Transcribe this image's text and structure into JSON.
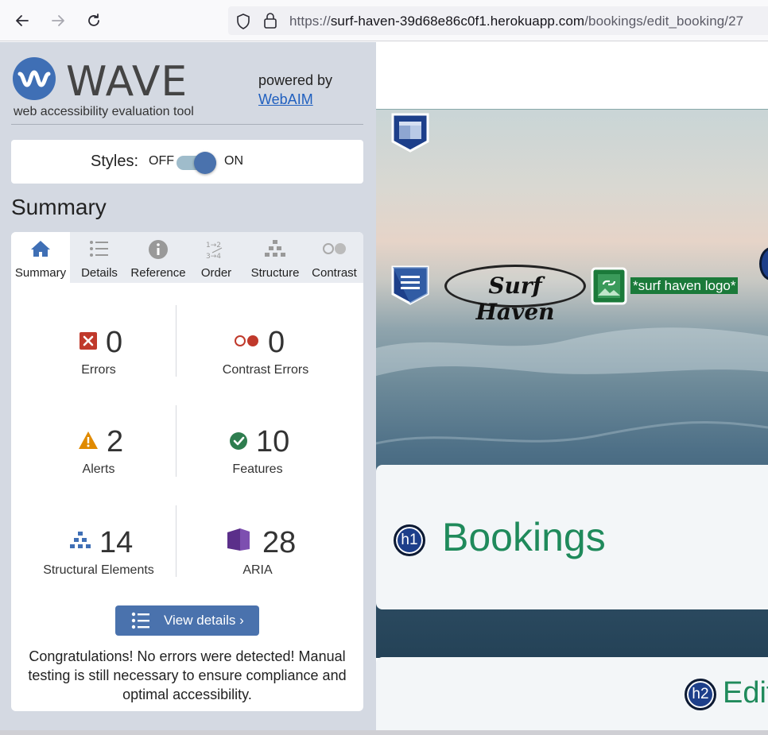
{
  "browser": {
    "url_prefix": "https://",
    "url_host": "surf-haven-39d68e86c0f1.herokuapp.com",
    "url_path": "/bookings/edit_booking/27",
    "icons": [
      "back-arrow-icon",
      "forward-arrow-icon",
      "reload-icon",
      "shield-icon",
      "lock-icon"
    ]
  },
  "wave": {
    "brand": "WAVE",
    "subtitle": "web accessibility evaluation tool",
    "powered_by": "powered by",
    "webaim_link": "WebAIM",
    "styles_label": "Styles:",
    "toggle_off": "OFF",
    "toggle_on": "ON",
    "toggle_state": "on",
    "summary_heading": "Summary",
    "tabs": [
      {
        "label": "Summary",
        "icon": "home-icon",
        "active": true
      },
      {
        "label": "Details",
        "icon": "list-icon",
        "active": false
      },
      {
        "label": "Reference",
        "icon": "info-icon",
        "active": false
      },
      {
        "label": "Order",
        "icon": "order-icon",
        "active": false
      },
      {
        "label": "Structure",
        "icon": "structure-icon",
        "active": false
      },
      {
        "label": "Contrast",
        "icon": "contrast-icon",
        "active": false
      }
    ],
    "stats": {
      "errors": {
        "value": "0",
        "label": "Errors"
      },
      "contrast_errors": {
        "value": "0",
        "label": "Contrast Errors"
      },
      "alerts": {
        "value": "2",
        "label": "Alerts"
      },
      "features": {
        "value": "10",
        "label": "Features"
      },
      "structural": {
        "value": "14",
        "label": "Structural Elements"
      },
      "aria": {
        "value": "28",
        "label": "ARIA"
      }
    },
    "view_details": "View details ›",
    "congrats": "Congratulations! No errors were detected! Manual testing is still necessary to ensure compliance and optimal accessibility.",
    "colors": {
      "accent": "#4a72ad",
      "error": "#c0392b",
      "alert": "#e08a00",
      "feature": "#2e7d4f",
      "aria": "#5b2f8a",
      "sidebar_bg": "#d4d9e2"
    }
  },
  "page": {
    "logo_text": "Surf Haven",
    "logo_alt_tag": "*surf haven logo*",
    "heading1": "Bookings",
    "heading2": "Edit",
    "h1_badge": "h1",
    "h2_badge": "h2",
    "heading_color": "#1f8a5b"
  }
}
